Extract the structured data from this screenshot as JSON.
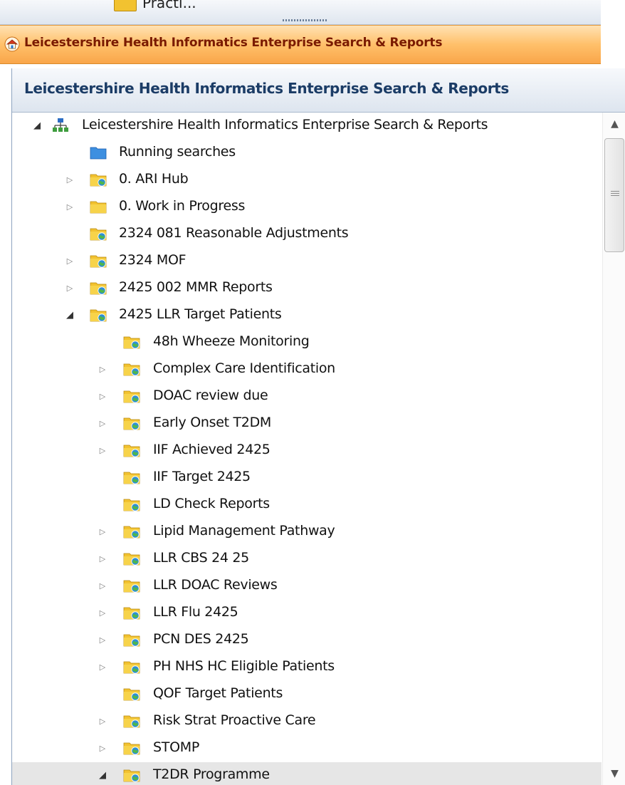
{
  "top_strip": {
    "partial_label": "Practi..."
  },
  "app_bar": {
    "title": "Leicestershire Health Informatics Enterprise Search & Reports",
    "icon": "home-icon"
  },
  "panel": {
    "title": "Leicestershire Health Informatics Enterprise Search & Reports"
  },
  "colors": {
    "app_bar_accent": "#f9a64a",
    "app_bar_text": "#7a1a00",
    "panel_title": "#1b3c66",
    "folder_yellow": "#f2c230",
    "folder_blue": "#3d8fe0",
    "selected_row": "#e6e6e6"
  },
  "tree": [
    {
      "label": "Leicestershire Health Informatics Enterprise Search & Reports",
      "level": 0,
      "expander": "expanded",
      "icon": "hierarchy-icon"
    },
    {
      "label": "Running searches",
      "level": 1,
      "expander": "none",
      "icon": "blue-folder-icon"
    },
    {
      "label": "0. ARI Hub",
      "level": 1,
      "expander": "collapsed",
      "icon": "shared-folder-icon"
    },
    {
      "label": "0. Work in Progress",
      "level": 1,
      "expander": "collapsed",
      "icon": "folder-icon"
    },
    {
      "label": "2324 081 Reasonable Adjustments",
      "level": 1,
      "expander": "none",
      "icon": "shared-folder-icon"
    },
    {
      "label": "2324 MOF",
      "level": 1,
      "expander": "collapsed",
      "icon": "shared-folder-icon"
    },
    {
      "label": "2425 002 MMR Reports",
      "level": 1,
      "expander": "collapsed",
      "icon": "shared-folder-icon"
    },
    {
      "label": "2425 LLR Target Patients",
      "level": 1,
      "expander": "expanded",
      "icon": "shared-folder-icon"
    },
    {
      "label": "48h Wheeze Monitoring",
      "level": 2,
      "expander": "none",
      "icon": "shared-folder-icon"
    },
    {
      "label": "Complex Care Identification",
      "level": 2,
      "expander": "collapsed",
      "icon": "shared-folder-icon"
    },
    {
      "label": "DOAC review due",
      "level": 2,
      "expander": "collapsed",
      "icon": "shared-folder-icon"
    },
    {
      "label": "Early Onset T2DM",
      "level": 2,
      "expander": "collapsed",
      "icon": "shared-folder-icon"
    },
    {
      "label": "IIF Achieved 2425",
      "level": 2,
      "expander": "collapsed",
      "icon": "shared-folder-icon"
    },
    {
      "label": "IIF Target 2425",
      "level": 2,
      "expander": "none",
      "icon": "shared-folder-icon"
    },
    {
      "label": "LD Check Reports",
      "level": 2,
      "expander": "none",
      "icon": "shared-folder-icon"
    },
    {
      "label": "Lipid Management Pathway",
      "level": 2,
      "expander": "collapsed",
      "icon": "shared-folder-icon"
    },
    {
      "label": "LLR CBS 24 25",
      "level": 2,
      "expander": "collapsed",
      "icon": "shared-folder-icon"
    },
    {
      "label": "LLR DOAC Reviews",
      "level": 2,
      "expander": "collapsed",
      "icon": "shared-folder-icon"
    },
    {
      "label": "LLR Flu 2425",
      "level": 2,
      "expander": "collapsed",
      "icon": "shared-folder-icon"
    },
    {
      "label": "PCN DES 2425",
      "level": 2,
      "expander": "collapsed",
      "icon": "shared-folder-icon"
    },
    {
      "label": "PH NHS HC Eligible Patients",
      "level": 2,
      "expander": "collapsed",
      "icon": "shared-folder-icon"
    },
    {
      "label": "QOF Target Patients",
      "level": 2,
      "expander": "none",
      "icon": "shared-folder-icon"
    },
    {
      "label": "Risk Strat Proactive Care",
      "level": 2,
      "expander": "collapsed",
      "icon": "shared-folder-icon"
    },
    {
      "label": "STOMP",
      "level": 2,
      "expander": "collapsed",
      "icon": "shared-folder-icon"
    },
    {
      "label": "T2DR Programme",
      "level": 2,
      "expander": "expanded",
      "icon": "shared-folder-icon",
      "selected": true
    }
  ]
}
